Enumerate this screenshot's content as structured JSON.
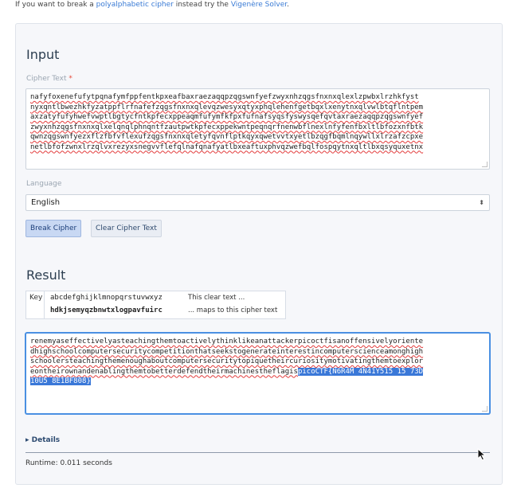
{
  "intro": {
    "prefix": "If you want to break a ",
    "link1": "polyalphabetic cipher",
    "middle": " instead try the ",
    "link2": "Vigenère Solver",
    "suffix": "."
  },
  "input": {
    "title": "Input",
    "cipher_label": "Cipher Text",
    "required_mark": "*",
    "cipher_lines": [
      "nafyfoxenefufytpqnafymfppfentkpxeafbaxraezaqqpzqgswnfyefzwyxnhzqgsfnxnxqlexlzpwbxlrzhkfyst",
      "nyxqntlbwezhkfyzatppflrfnafefzqgsfnxnxqlevqzwesyxqtyxphqlehenfgetbqxlxenytnxqlvwlbtqflntpem",
      "axzatyfufyhwefvwptlbgtycfntkpfecxppeaqmfufymfkfpxfufnafsyqsfyswysqefqvtaxraezaqqpzqgswnfyef",
      "zwyxnhzqgsfnxnxqlxelqnqlphnqntfzautpwtkpfecxppekwntpeqnqrfnenwbflnexlnfyfenfbxltlbfozxnfbtk",
      "qwnzqgswnfyezxflzfbfvflexufzqgsfnxnxqletyfqvnflptkqyxqwetvvtxyetlbzqgfbqmlnqywllxlrzafzcpxe",
      "netlbfofzwnxlrzqlvxrezyxsnegvvflefqlnafqnafyatlbxeaftuxphvqzwefbqlfospqytnxqltlbxqsyquxetnx"
    ],
    "language_label": "Language",
    "language_value": "English",
    "break_button": "Break Cipher",
    "clear_button": "Clear Cipher Text"
  },
  "result": {
    "title": "Result",
    "key_label": "Key",
    "plain_alphabet": "abcdefghijklmnopqrstuvwxyz",
    "cipher_alphabet": "hdkjsemyqzbnwtxlogpavfuirc",
    "plain_note": "This clear text ...",
    "cipher_note": "... maps to this cipher text",
    "plain_lines": [
      "renemyaseffectivelyasteachingthemtoactivelythinklikeanattackerpicoctfisanoffensivelyoriente",
      "dhighschoolcomputersecuritycompetitionthatseekstogenerateinterestincomputerscienceamonghigh",
      "schoolersteachingthemenoughaboutcomputersecuritytopiquetheircuriositymotivatingthemtoexplor",
      "eontheirownandenablingthemtobetterdefendtheirmachinestheflagis"
    ],
    "flag_part1": "picoCTF{N6R4M 4N41Y515 15 73D",
    "flag_part2": "10U5 8E1BF808}",
    "details_label": "Details",
    "runtime_text": "Runtime: 0.011 seconds"
  },
  "icons": {
    "select_arrow": "updown-arrow-icon",
    "details_caret": "caret-right-icon",
    "cursor": "mouse-pointer-icon"
  },
  "colors": {
    "accent": "#3a78d8",
    "selection": "#3a78d8",
    "required": "#e74c3c",
    "panel_bg": "#f6f7fa"
  }
}
